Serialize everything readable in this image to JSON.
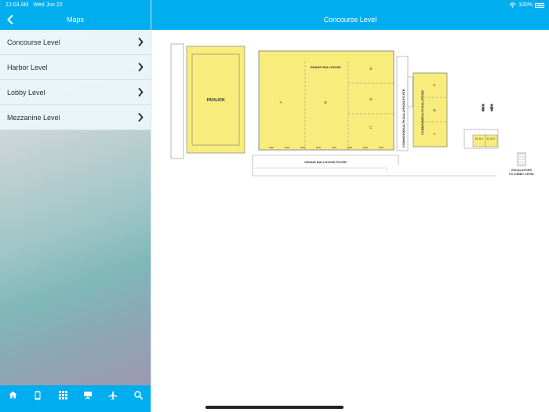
{
  "status_bar": {
    "time": "12:03 AM",
    "date": "Wed Jun 22",
    "battery": "100%"
  },
  "sidebar": {
    "title": "Maps",
    "items": [
      {
        "label": "Concourse Level"
      },
      {
        "label": "Harbor Level"
      },
      {
        "label": "Lobby Level"
      },
      {
        "label": "Mezzanine Level"
      }
    ]
  },
  "main": {
    "title": "Concourse Level"
  },
  "floor_plan": {
    "pavilion": "PAVILION",
    "grand_ballroom": "GRAND BALLROOM",
    "grand_ballroom_sections": [
      "A",
      "B",
      "C",
      "D",
      "E"
    ],
    "grand_ballroom_foyer": "GRAND BALLROOM FOYER",
    "commonwealth_foyer": "COMMONWEALTH BALLROOM FOYER",
    "commonwealth_ballroom": "COMMONWEALTH BALLROOM",
    "commonwealth_sections": [
      "C",
      "B",
      "A"
    ],
    "elevator_lobby_1": "EL M 1",
    "elevator_lobby_2": "EL M 2",
    "escalators_line1": "ESCALATORS",
    "escalators_line2": "TO LOBBY LEVEL"
  },
  "tabbar": {
    "tabs": [
      {
        "icon": "home-icon"
      },
      {
        "icon": "mobile-icon"
      },
      {
        "icon": "grid-icon"
      },
      {
        "icon": "presentation-icon"
      },
      {
        "icon": "airplane-icon"
      },
      {
        "icon": "search-icon"
      }
    ]
  },
  "colors": {
    "accent": "#00adee",
    "room_fill": "#f8ec7c",
    "menu_bg": "#ebf6fb"
  }
}
